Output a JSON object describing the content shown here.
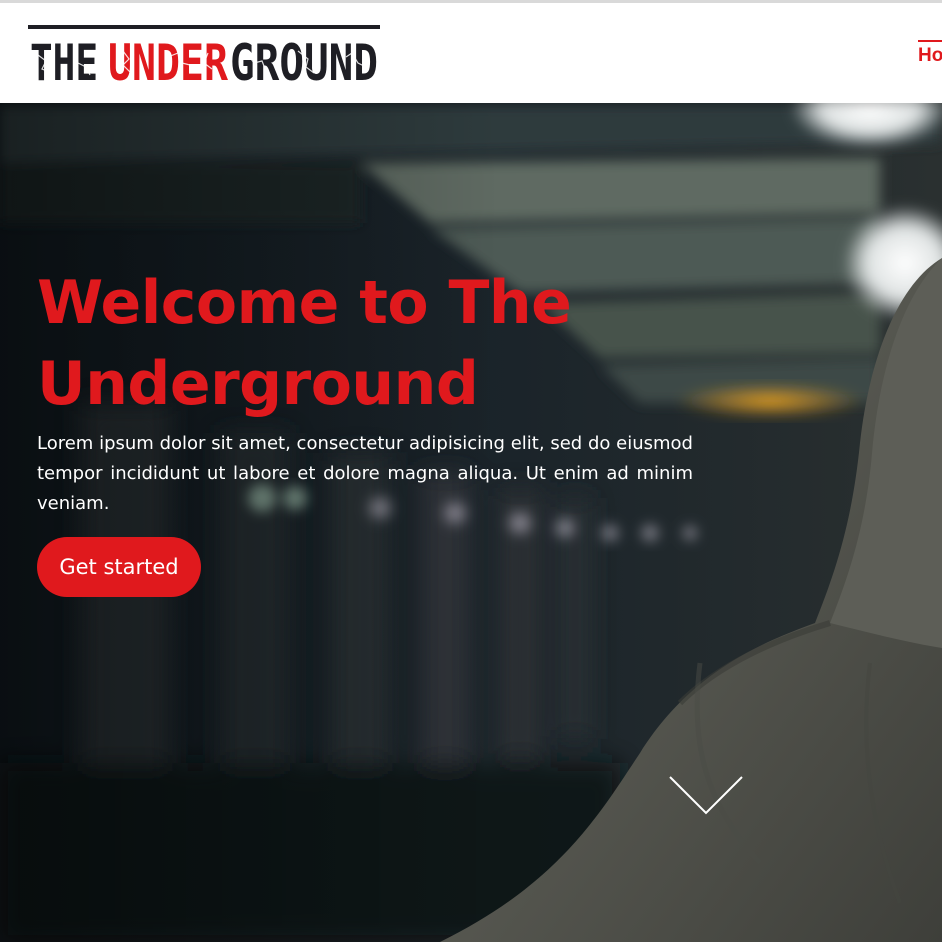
{
  "header": {
    "logo": {
      "text": "THE UNDERGROUND",
      "part1": "THE",
      "part2": "UNDER",
      "part3": "GROUND"
    },
    "nav": {
      "home_label": "Ho"
    }
  },
  "hero": {
    "title_line1": "Welcome to The",
    "title_line2": "Underground",
    "description": "Lorem ipsum dolor sit amet, consectetur adipisicing elit, sed do eiusmod tempor incididunt ut labore et dolore magna aliqua. Ut enim ad minim veniam.",
    "cta_label": "Get started",
    "scroll_icon": "chevron-down-icon",
    "background": "subway-platform-hooded-person-photo"
  },
  "colors": {
    "accent": "#e0191d",
    "logo_dark": "#1e1e24",
    "nav_bg": "#ffffff",
    "hero_text": "#ffffff"
  }
}
